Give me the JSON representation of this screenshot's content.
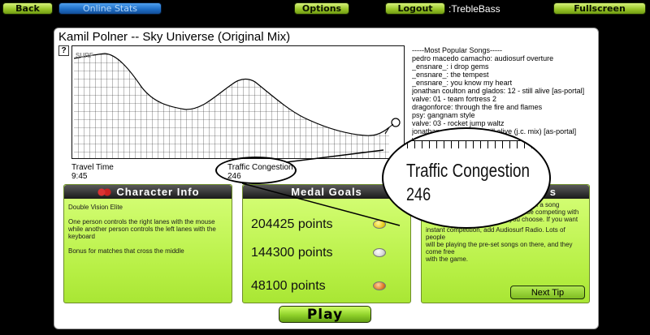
{
  "topbar": {
    "back_label": "Back",
    "online_stats_label": "Online Stats",
    "options_label": "Options",
    "logout_label": "Logout",
    "username": ":TrebleBass",
    "fullscreen_label": "Fullscreen"
  },
  "song": {
    "title": "Kamil Polner -- Sky Universe (Original Mix)",
    "graph_brand": "SURF"
  },
  "popular_songs": {
    "header": "-----Most Popular Songs-----",
    "items": [
      "pedro macedo camacho: audiosurf overture",
      "_ensnare_: i drop gems",
      "_ensnare_: the tempest",
      "_ensnare_: you know my heart",
      "jonathan coulton and glados: 12 - still alive [as-portal]",
      "valve: 01 - team fortress 2",
      "dragonforce: through the fire and flames",
      "psy: gangnam style",
      "valve: 03 - rocket jump waltz",
      "jonathan coulton: 12 - still alive (j.c. mix) [as-portal]",
      "yo..."
    ]
  },
  "stats": {
    "travel_time_label": "Travel Time",
    "travel_time_value": "9:45",
    "traffic_label": "Traffic Congestion",
    "traffic_value": "246"
  },
  "character_info": {
    "title": "Character Info",
    "name": "Double Vision Elite",
    "description": "One person controls the right lanes with the mouse while another person controls the left lanes with the keyboard",
    "bonus": "Bonus for matches that cross the middle"
  },
  "medal_goals": {
    "title": "Medal Goals",
    "goals": [
      {
        "points": "204425 points",
        "color": "#e8d020"
      },
      {
        "points": "144300 points",
        "color": "#d8d8d8"
      },
      {
        "points": "48100 points",
        "color": "#e0802a"
      }
    ]
  },
  "tips": {
    "title_fragment": "s",
    "line1": "scored on a song",
    "line2": "ody else competing with",
    "line3": "you choose. If you want",
    "line4": "instant competition, add Audiosurf Radio. Lots of people",
    "line5": "will be playing the pre-set songs on there, and they come free",
    "line6": "with the game.",
    "next_tip_label": "Next Tip"
  },
  "play_label": "Play",
  "colors": {
    "accent_green": "#a9e634",
    "button_blue": "#1f6fc8"
  }
}
